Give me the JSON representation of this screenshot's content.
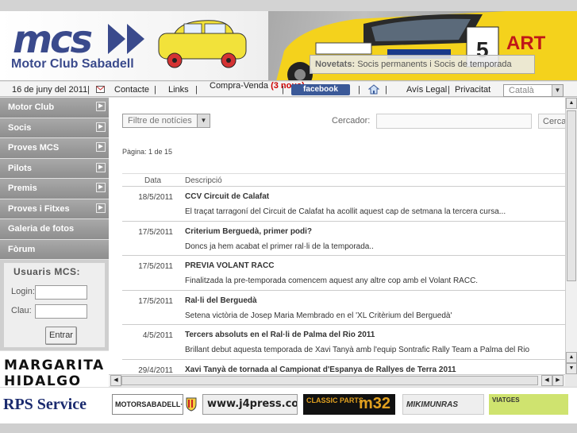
{
  "header": {
    "logo": "mcs",
    "club_name": "Motor Club Sabadell",
    "news_label": "Novetats:",
    "news_text": "Socis permanents i Socis de temporada"
  },
  "nav": {
    "date": "16 de juny del 2011",
    "contact": "Contacte",
    "links": "Links",
    "buysell": "Compra-Venda",
    "buysell_count": "(3 nous)",
    "facebook": "facebook",
    "legal": "Avís Legal",
    "privacy": "Privacitat",
    "language": "Català"
  },
  "sidebar": {
    "items": [
      {
        "label": "Motor Club",
        "has_arrow": true
      },
      {
        "label": "Socis",
        "has_arrow": true
      },
      {
        "label": "Proves MCS",
        "has_arrow": true
      },
      {
        "label": "Pilots",
        "has_arrow": true
      },
      {
        "label": "Premis",
        "has_arrow": true
      },
      {
        "label": "Proves i Fitxes",
        "has_arrow": true
      },
      {
        "label": "Galeria de fotos",
        "has_arrow": false
      },
      {
        "label": "Fòrum",
        "has_arrow": false
      }
    ],
    "login": {
      "title": "Usuaris MCS:",
      "user_label": "Login:",
      "pass_label": "Clau:",
      "button": "Entrar"
    },
    "ad": {
      "line1": "MARGARITA",
      "line2": "HIDALGO"
    }
  },
  "main": {
    "filter": "Filtre de notícies",
    "search_label": "Cercador:",
    "search_button": "Cerca",
    "page_info": "Pàgina: 1 de 15",
    "col_date": "Data",
    "col_desc": "Descripció",
    "news": [
      {
        "date": "18/5/2011",
        "title": "CCV Circuit de Calafat",
        "desc": "El traçat tarragoní del Circuit de Calafat ha acollit aquest cap de setmana la tercera cursa..."
      },
      {
        "date": "17/5/2011",
        "title": "Criterium Berguedà, primer podi?",
        "desc": "Doncs ja hem acabat el primer ral·li de la temporada.."
      },
      {
        "date": "17/5/2011",
        "title": "PREVIA VOLANT RACC",
        "desc": "Finalitzada la pre-temporada comencem aquest any altre cop amb el Volant RACC."
      },
      {
        "date": "17/5/2011",
        "title": "Ral·li del Berguedà",
        "desc": "Setena victòria de Josep Maria Membrado en el 'XL Critèrium del Berguedà'"
      },
      {
        "date": "4/5/2011",
        "title": "Tercers absoluts en el Ral·li de Palma del Rio 2011",
        "desc": "Brillant debut aquesta temporada de Xavi Tanyà amb l'equip Sontrafic Rally Team a Palma del Rio"
      },
      {
        "date": "29/4/2011",
        "title": "Xavi Tanyà de tornada al Campionat d'Espanya de Rallyes de Terra 2011",
        "desc": ""
      }
    ]
  },
  "sponsors": {
    "rps": "RPS Service",
    "motorsabadell": "MOTORSABADELL·COM",
    "j4press": "www.j4press.com",
    "m32_small": "CLASSIC PARTS",
    "m32_big": "m32",
    "miki": "MIKIMUNRAS",
    "viatges": "VIATGES"
  },
  "colors": {
    "brand": "#3a4a8c",
    "menu": "#9a9a9a",
    "facebook": "#3b5998",
    "highlight": "#cc0000"
  }
}
